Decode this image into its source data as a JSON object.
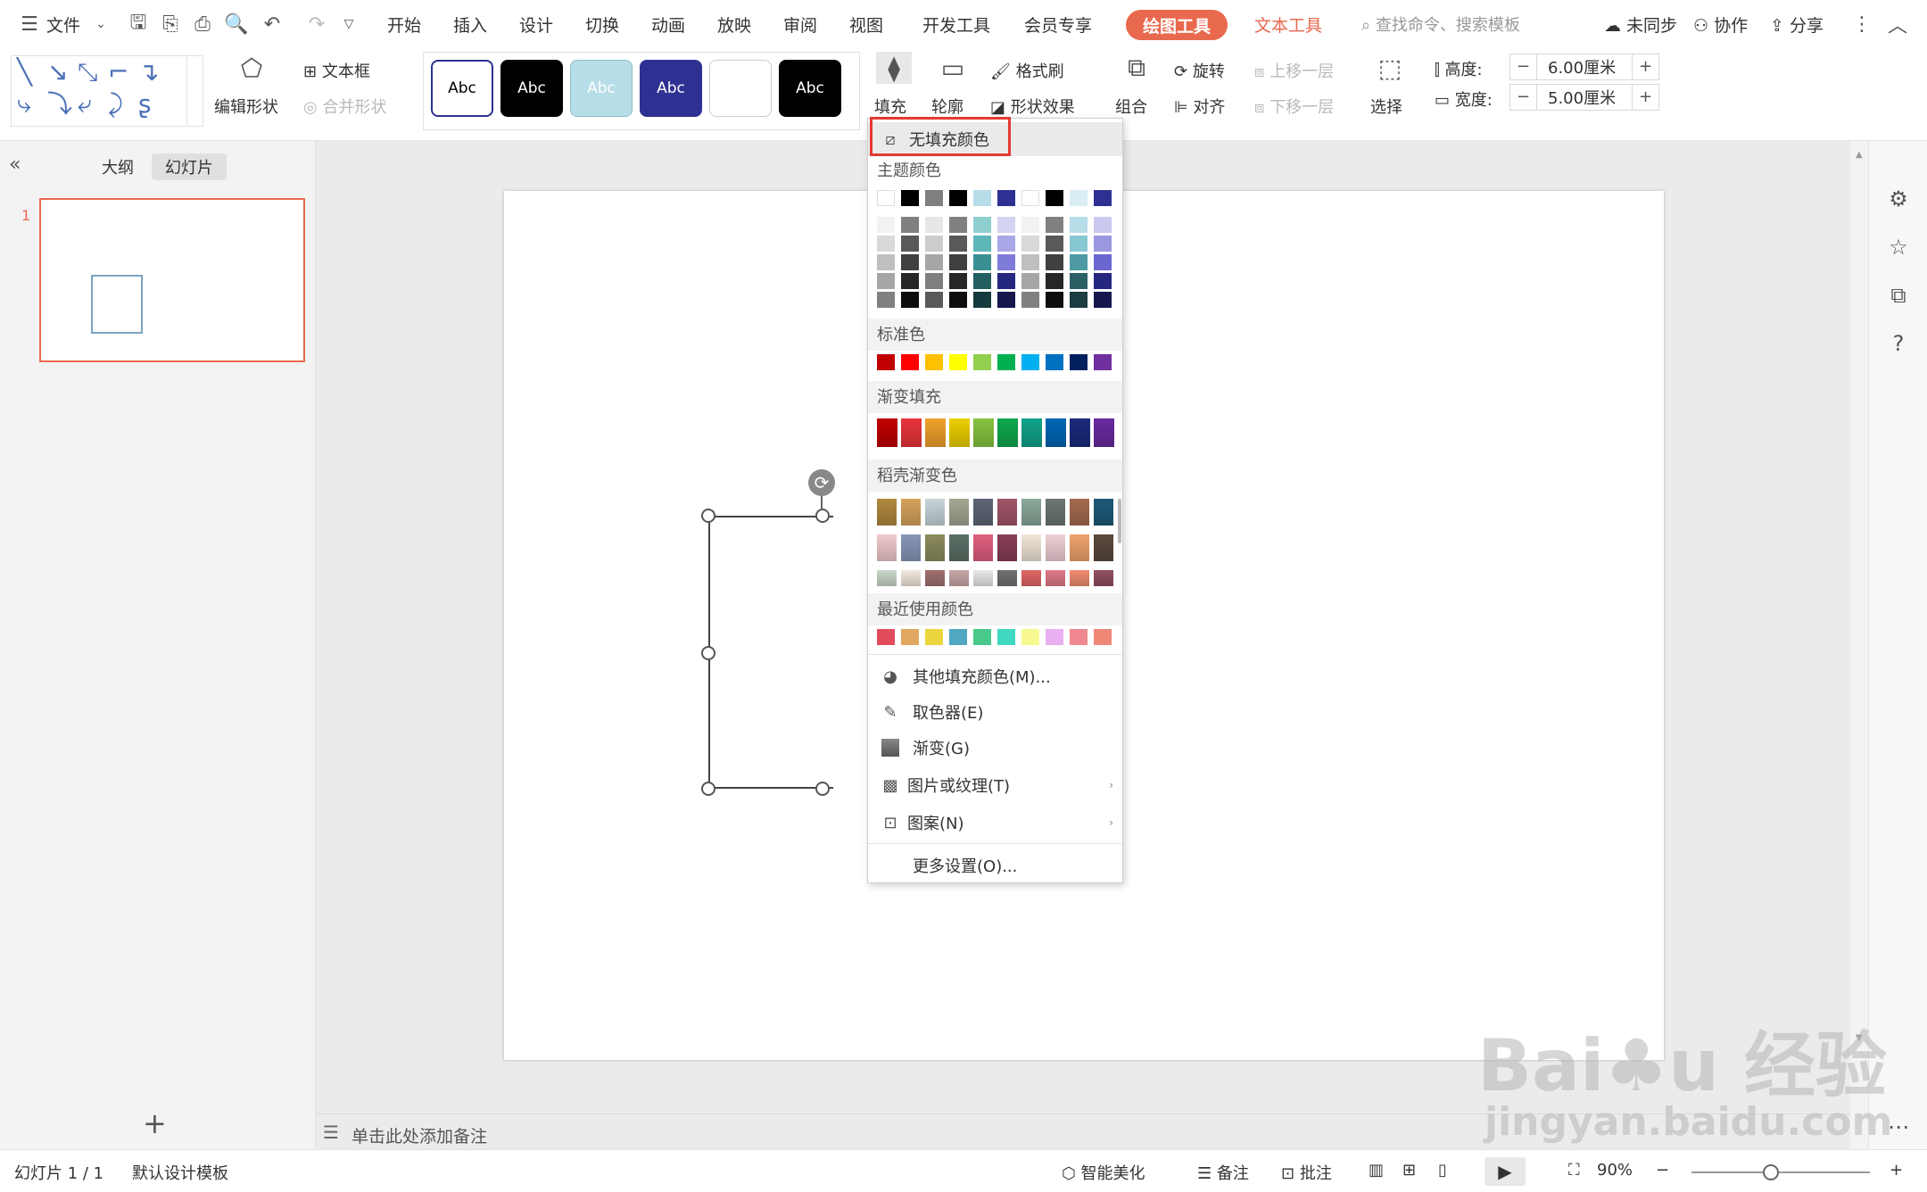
{
  "menubar": {
    "file": "文件",
    "tabs": [
      "开始",
      "插入",
      "设计",
      "切换",
      "动画",
      "放映",
      "审阅",
      "视图",
      "开发工具",
      "会员专享"
    ],
    "drawing_tools": "绘图工具",
    "text_tools": "文本工具",
    "search_placeholder": "查找命令、搜索模板",
    "not_synced": "未同步",
    "collaborate": "协作",
    "share": "分享"
  },
  "ribbon": {
    "edit_shape": "编辑形状",
    "text_box": "文本框",
    "merge_shape": "合并形状",
    "style_label": "Abc",
    "fill": "填充",
    "outline": "轮廓",
    "format_painter": "格式刷",
    "shape_effect": "形状效果",
    "group": "组合",
    "rotate": "旋转",
    "align": "对齐",
    "bring_forward": "上移一层",
    "send_backward": "下移一层",
    "select": "选择",
    "height_label": "高度:",
    "height_value": "6.00厘米",
    "width_label": "宽度:",
    "width_value": "5.00厘米"
  },
  "left_panel": {
    "outline_tab": "大纲",
    "slides_tab": "幻灯片",
    "slide_number": "1"
  },
  "notes_placeholder": "单击此处添加备注",
  "status": {
    "slide_info": "幻灯片 1 / 1",
    "template": "默认设计模板",
    "smart_beautify": "智能美化",
    "notes": "备注",
    "comments": "批注",
    "zoom": "90%"
  },
  "fill_menu": {
    "no_fill": "无填充颜色",
    "theme_colors": "主题颜色",
    "standard_colors": "标准色",
    "gradient_fill": "渐变填充",
    "docer_gradient": "稻壳渐变色",
    "recent_colors": "最近使用颜色",
    "more_fill": "其他填充颜色(M)...",
    "eyedropper": "取色器(E)",
    "gradient": "渐变(G)",
    "picture_texture": "图片或纹理(T)",
    "pattern": "图案(N)",
    "more_settings": "更多设置(O)...",
    "theme_top": [
      "#ffffff",
      "#000000",
      "#7f7f7f",
      "#000000",
      "#b7dde8",
      "#2e3192",
      "#ffffff",
      "#000000",
      "#d9eef3",
      "#2e3192"
    ],
    "theme_columns": [
      [
        "#f2f2f2",
        "#d9d9d9",
        "#bfbfbf",
        "#a6a6a6",
        "#808080"
      ],
      [
        "#808080",
        "#595959",
        "#404040",
        "#262626",
        "#0d0d0d"
      ],
      [
        "#e6e6e6",
        "#cccccc",
        "#a6a6a6",
        "#7f7f7f",
        "#595959"
      ],
      [
        "#808080",
        "#595959",
        "#404040",
        "#262626",
        "#0d0d0d"
      ],
      [
        "#8fcfd0",
        "#5fb6b8",
        "#3a8f93",
        "#235e61",
        "#143b3d"
      ],
      [
        "#d4d3f2",
        "#a9a7e5",
        "#7f7bd8",
        "#252680",
        "#16174d"
      ],
      [
        "#f2f2f2",
        "#d9d9d9",
        "#bfbfbf",
        "#a6a6a6",
        "#808080"
      ],
      [
        "#808080",
        "#595959",
        "#404040",
        "#262626",
        "#0d0d0d"
      ],
      [
        "#b7dde8",
        "#86c7d2",
        "#4e9aa5",
        "#2c5e66",
        "#1b3c41"
      ],
      [
        "#c9c9f0",
        "#9a98e0",
        "#6c67d0",
        "#252680",
        "#16174d"
      ]
    ],
    "standard": [
      "#c00000",
      "#ff0000",
      "#ffc000",
      "#ffff00",
      "#92d050",
      "#00b050",
      "#00b0f0",
      "#0070c0",
      "#002060",
      "#7030a0"
    ],
    "gradient_swatches": [
      "#c00000",
      "#e8343a",
      "#f0a12c",
      "#ecd000",
      "#86c440",
      "#10a84e",
      "#11a38a",
      "#0066b5",
      "#1a2a7c",
      "#6a2aa0"
    ],
    "docer_rows": [
      [
        "#b08a3e",
        "#d6a45c",
        "#c7d6d9",
        "#a3a793",
        "#5e6675",
        "#a05668",
        "#8aa89a",
        "#6c7774",
        "#a56a50",
        "#1d5a78"
      ],
      [
        "#f0c9cc",
        "#8897b8",
        "#8c8c5e",
        "#5c7066",
        "#e05f7e",
        "#8a3e55",
        "#f1e6d8",
        "#efcfd7",
        "#f0a36c",
        "#5a4a3e"
      ],
      [
        "#cad6c9",
        "#f1e9df",
        "#a07070",
        "#c8a7a7",
        "#e8e8e8",
        "#707070",
        "#e06666",
        "#e07a8a",
        "#f08c70",
        "#905060"
      ]
    ],
    "recent": [
      "#e04c5c",
      "#e0a860",
      "#ecd640",
      "#50a8c0",
      "#48c88a",
      "#40d8c0",
      "#f8f890",
      "#e8b0f0",
      "#f08890",
      "#f08878"
    ]
  }
}
